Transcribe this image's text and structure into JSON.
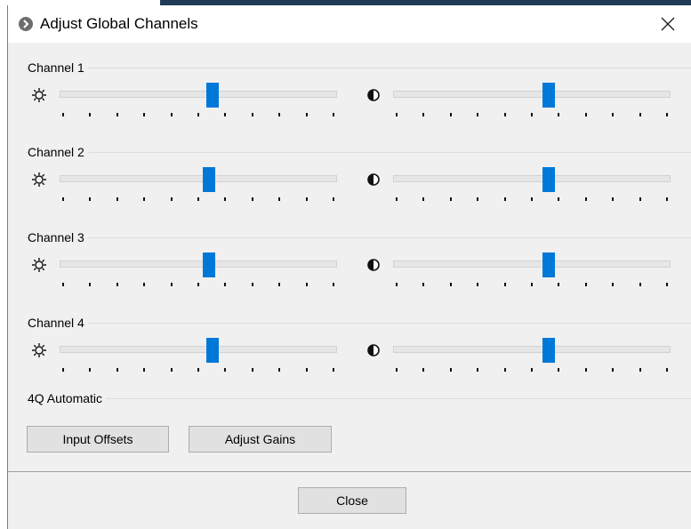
{
  "window": {
    "title": "Adjust Global Channels",
    "close_glyph": "✕"
  },
  "channels": [
    {
      "label": "Channel 1",
      "brightness": 0.55,
      "contrast": 0.56
    },
    {
      "label": "Channel 2",
      "brightness": 0.54,
      "contrast": 0.56
    },
    {
      "label": "Channel 3",
      "brightness": 0.54,
      "contrast": 0.56
    },
    {
      "label": "Channel 4",
      "brightness": 0.55,
      "contrast": 0.56
    }
  ],
  "automatic": {
    "label": "4Q Automatic",
    "input_offsets_label": "Input Offsets",
    "adjust_gains_label": "Adjust Gains"
  },
  "footer": {
    "close_label": "Close"
  },
  "icons": {
    "brightness": "sun-icon",
    "contrast": "contrast-icon"
  },
  "colors": {
    "thumb": "#0078d7"
  }
}
